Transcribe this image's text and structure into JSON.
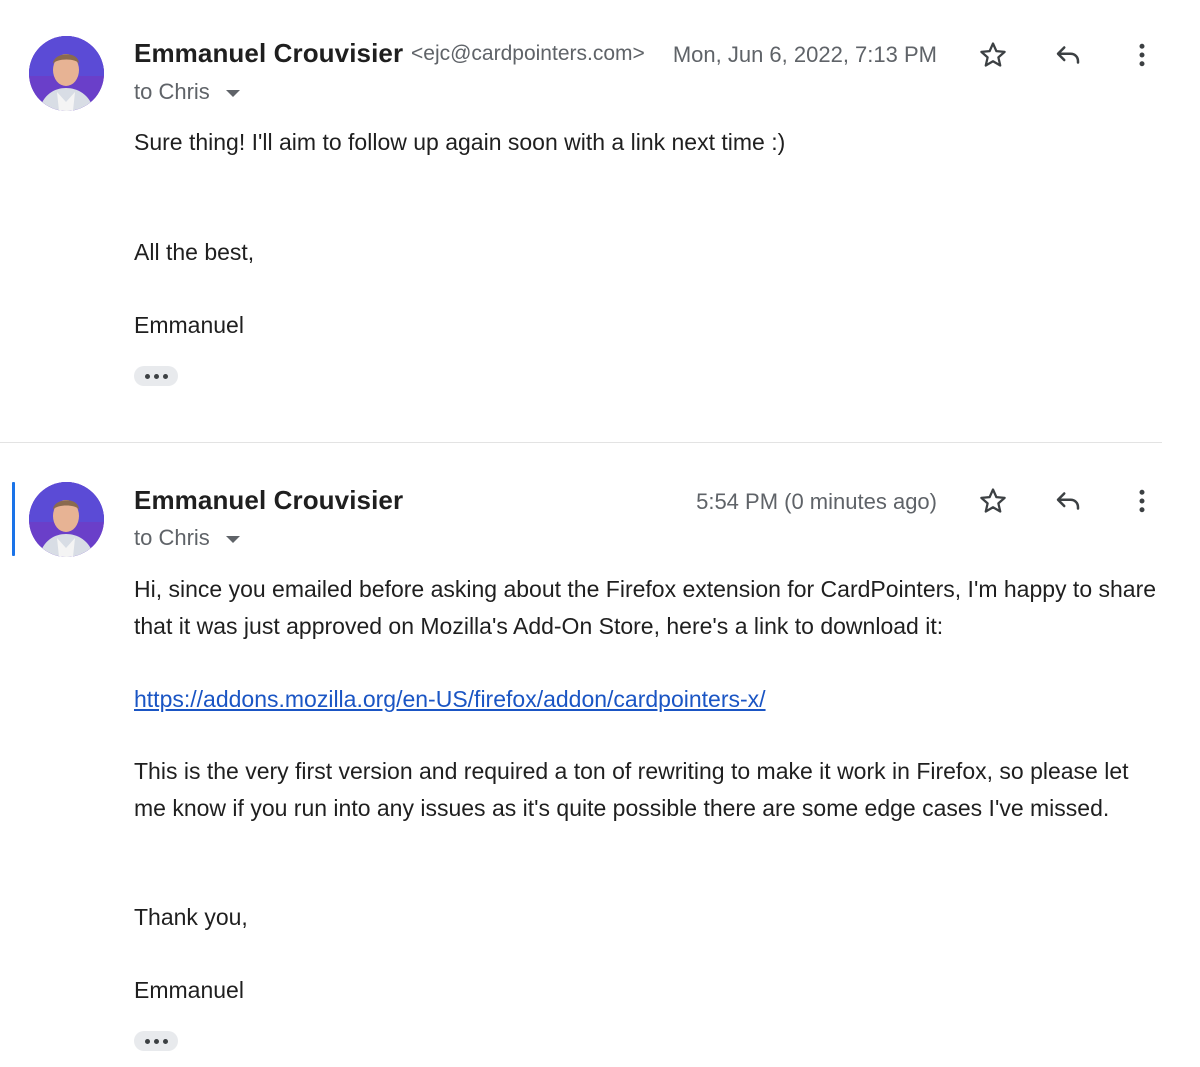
{
  "messages": [
    {
      "sender_name": "Emmanuel Crouvisier",
      "sender_email": "<ejc@cardpointers.com>",
      "timestamp": "Mon, Jun 6, 2022, 7:13 PM",
      "to_label": "to Chris",
      "body": {
        "line1": "Sure thing! I'll aim to follow up again soon with a link next time :)",
        "signoff": "All the best,",
        "signature": "Emmanuel"
      }
    },
    {
      "sender_name": "Emmanuel Crouvisier",
      "timestamp": "5:54 PM (0 minutes ago)",
      "to_label": "to Chris",
      "body": {
        "para1": "Hi, since you emailed before asking about the Firefox extension for CardPointers, I'm happy to share that it was just approved on Mozilla's Add-On Store, here's a link to download it:",
        "link": "https://addons.mozilla.org/en-US/firefox/addon/cardpointers-x/",
        "para2": "This is the very first version and required a ton of rewriting to make it work in Firefox, so please let me know if you run into any issues as it's quite possible there are some edge cases I've missed.",
        "signoff": "Thank you,",
        "signature": "Emmanuel"
      }
    }
  ],
  "icons": {
    "star": "star-icon",
    "reply": "reply-icon",
    "more": "more-vert-icon",
    "caret": "chevron-down-icon",
    "ellipsis": "ellipsis-icon"
  },
  "colors": {
    "accent_blue": "#1a73e8",
    "link_blue": "#1a55c4",
    "secondary_text": "#5f6368",
    "avatar_bg": "#6a3fc9"
  }
}
